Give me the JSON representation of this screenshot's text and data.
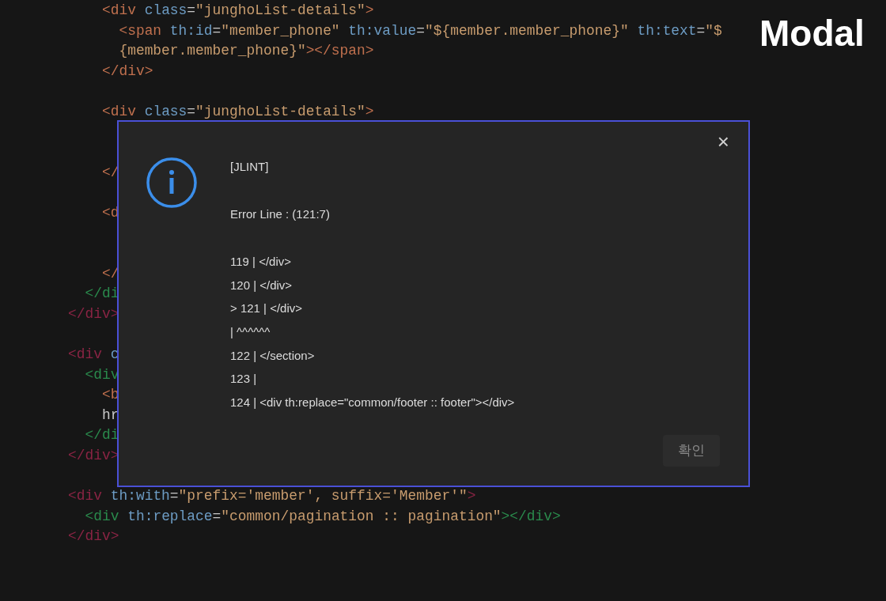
{
  "corner_label": "Modal",
  "code_lines": [
    {
      "kind": "code",
      "tokens": [
        {
          "kind": "tag3",
          "text": "    <div"
        },
        {
          "kind": "attr",
          "text": " class"
        },
        {
          "kind": "punc",
          "text": "="
        },
        {
          "kind": "str",
          "text": "\"junghoList-details\""
        },
        {
          "kind": "tag3",
          "text": ">"
        }
      ]
    },
    {
      "kind": "code",
      "tokens": [
        {
          "kind": "tag3",
          "text": "      <span"
        },
        {
          "kind": "attr",
          "text": " th:id"
        },
        {
          "kind": "punc",
          "text": "="
        },
        {
          "kind": "str",
          "text": "\"member_phone\""
        },
        {
          "kind": "attr",
          "text": " th:value"
        },
        {
          "kind": "punc",
          "text": "="
        },
        {
          "kind": "str",
          "text": "\"${member.member_phone}\""
        },
        {
          "kind": "attr",
          "text": " th:text"
        },
        {
          "kind": "punc",
          "text": "="
        },
        {
          "kind": "str",
          "text": "\"$"
        }
      ]
    },
    {
      "kind": "code",
      "tokens": [
        {
          "kind": "str",
          "text": "      {member.member_phone}\""
        },
        {
          "kind": "tag3",
          "text": "></span>"
        }
      ]
    },
    {
      "kind": "code",
      "tokens": [
        {
          "kind": "tag3",
          "text": "    </div>"
        }
      ]
    },
    {
      "kind": "blank"
    },
    {
      "kind": "code",
      "tokens": [
        {
          "kind": "tag3",
          "text": "    <div"
        },
        {
          "kind": "attr",
          "text": " class"
        },
        {
          "kind": "punc",
          "text": "="
        },
        {
          "kind": "str",
          "text": "\"junghoList-details\""
        },
        {
          "kind": "tag3",
          "text": ">"
        }
      ]
    },
    {
      "kind": "blank"
    },
    {
      "kind": "blank"
    },
    {
      "kind": "code",
      "tokens": [
        {
          "kind": "tag3",
          "text": "    </"
        }
      ]
    },
    {
      "kind": "blank"
    },
    {
      "kind": "code",
      "tokens": [
        {
          "kind": "tag3",
          "text": "    <d"
        }
      ]
    },
    {
      "kind": "blank"
    },
    {
      "kind": "blank"
    },
    {
      "kind": "code",
      "tokens": [
        {
          "kind": "tag3",
          "text": "    </"
        }
      ]
    },
    {
      "kind": "code",
      "tokens": [
        {
          "kind": "tag2",
          "text": "  </di"
        }
      ]
    },
    {
      "kind": "code",
      "tokens": [
        {
          "kind": "tag1",
          "text": "</div>"
        }
      ]
    },
    {
      "kind": "blank"
    },
    {
      "kind": "code",
      "tokens": [
        {
          "kind": "tag1",
          "text": "<div"
        },
        {
          "kind": "attr",
          "text": " c"
        }
      ]
    },
    {
      "kind": "code",
      "tokens": [
        {
          "kind": "tag2",
          "text": "  <div"
        }
      ]
    },
    {
      "kind": "code",
      "tokens": [
        {
          "kind": "tag3",
          "text": "    <b"
        }
      ]
    },
    {
      "kind": "code",
      "tokens": [
        {
          "kind": "plain",
          "text": "    hr"
        }
      ]
    },
    {
      "kind": "code",
      "tokens": [
        {
          "kind": "tag2",
          "text": "  </di"
        }
      ]
    },
    {
      "kind": "code",
      "tokens": [
        {
          "kind": "tag1",
          "text": "</div>"
        }
      ]
    },
    {
      "kind": "blank"
    },
    {
      "kind": "code",
      "tokens": [
        {
          "kind": "tag1",
          "text": "<div"
        },
        {
          "kind": "attr",
          "text": " th:with"
        },
        {
          "kind": "punc",
          "text": "="
        },
        {
          "kind": "str",
          "text": "\"prefix='member', suffix='Member'\""
        },
        {
          "kind": "tag1",
          "text": ">"
        }
      ]
    },
    {
      "kind": "code",
      "tokens": [
        {
          "kind": "tag2",
          "text": "  <div"
        },
        {
          "kind": "attr",
          "text": " th:replace"
        },
        {
          "kind": "punc",
          "text": "="
        },
        {
          "kind": "str",
          "text": "\"common/pagination :: pagination\""
        },
        {
          "kind": "tag2",
          "text": "></div>"
        }
      ]
    },
    {
      "kind": "code",
      "tokens": [
        {
          "kind": "tag1",
          "text": "</div>"
        }
      ]
    }
  ],
  "modal": {
    "close": "×",
    "source": "[JLINT]",
    "error_line": "Error Line : (121:7)",
    "snippet": [
      "119 | </div>",
      "120 | </div>",
      "> 121 | </div>",
      "| ^^^^^^",
      "122 | </section>",
      "123 |",
      "124 | <div th:replace=\"common/footer :: footer\"></div>"
    ],
    "confirm_button": "확인"
  }
}
